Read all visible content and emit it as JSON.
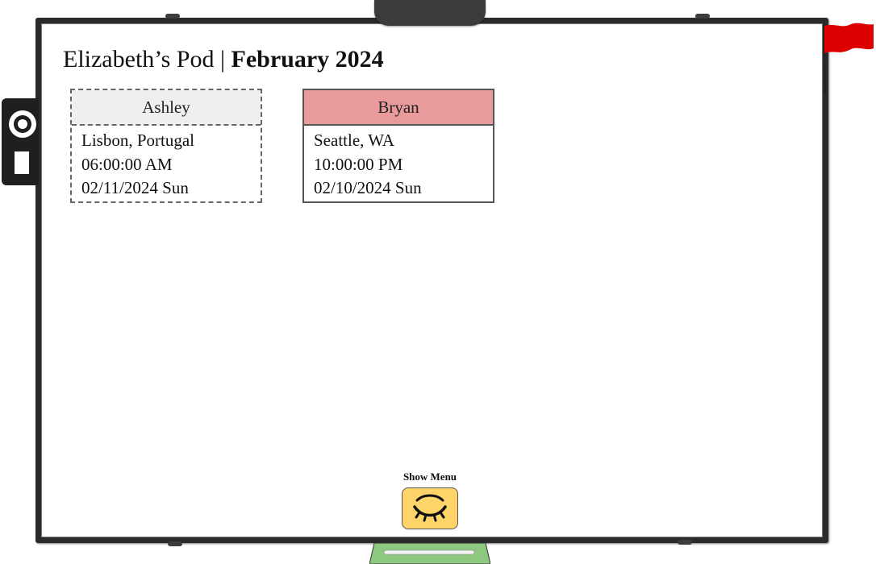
{
  "header": {
    "pod_name": "Elizabeth’s Pod",
    "separator": " | ",
    "month": "February 2024"
  },
  "cards": [
    {
      "name": "Ashley",
      "location": "Lisbon, Portugal",
      "time": "06:00:00 AM",
      "date": "02/11/2024 Sun",
      "header_color": "#efefef"
    },
    {
      "name": "Bryan",
      "location": "Seattle, WA",
      "time": "10:00:00 PM",
      "date": "02/10/2024 Sun",
      "header_color": "#e99a9a"
    }
  ],
  "menu": {
    "label": "Show Menu",
    "icon": "closed-eye-icon",
    "button_color": "#ffd56a"
  },
  "decor": {
    "flag_icon": "red-flag-icon",
    "flag_color": "#dd0000",
    "tray_color": "#8cc97f",
    "frame_color": "#2b2b2b"
  }
}
